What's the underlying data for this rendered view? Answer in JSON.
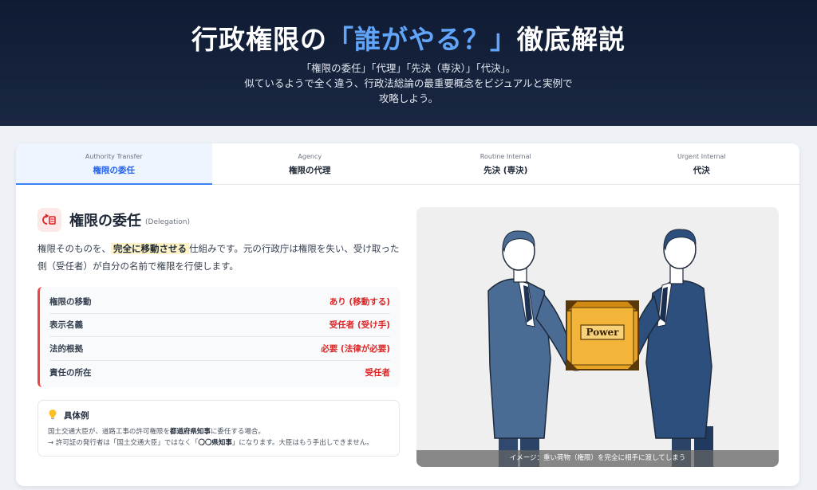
{
  "hero": {
    "title_pre": "行政権限の",
    "title_accent": "「誰がやる？」",
    "title_post": "徹底解説",
    "sub_line1": "「権限の委任」「代理」「先決（専決）」「代決」。",
    "sub_line2": "似ているようで全く違う、行政法総論の最重要概念をビジュアルと実例で",
    "sub_line3": "攻略しよう。"
  },
  "tabs": [
    {
      "en": "Authority Transfer",
      "jp": "権限の委任",
      "active": true
    },
    {
      "en": "Agency",
      "jp": "権限の代理",
      "active": false
    },
    {
      "en": "Routine Internal",
      "jp": "先決 (専決)",
      "active": false
    },
    {
      "en": "Urgent Internal",
      "jp": "代決",
      "active": false
    }
  ],
  "section": {
    "icon": "transfer-document-icon",
    "title": "権限の委任",
    "title_en": "(Delegation)",
    "desc_pre": "権限そのものを、",
    "desc_highlight": "完全に移動させる",
    "desc_post": "仕組みです。元の行政庁は権限を失い、受け取った側（受任者）が自分の名前で権限を行使します。"
  },
  "properties": [
    {
      "label": "権限の移動",
      "value": "あり (移動する)"
    },
    {
      "label": "表示名義",
      "value": "受任者 (受け手)"
    },
    {
      "label": "法的根拠",
      "value": "必要 (法律が必要)"
    },
    {
      "label": "責任の所在",
      "value": "受任者"
    }
  ],
  "example": {
    "icon": "lightbulb-icon",
    "title": "具体例",
    "line1_pre": "国土交通大臣が、道路工事の許可権限を",
    "line1_bold": "都道府県知事",
    "line1_post": "に委任する場合。",
    "line2_pre": "→ 許可証の発行者は「国土交通大臣」ではなく「",
    "line2_bold": "〇〇県知事",
    "line2_post": "」になります。大臣はもう手出しできません。"
  },
  "illustration": {
    "box_label": "Power",
    "caption": "イメージ：重い荷物（権限）を完全に相手に渡してしまう"
  },
  "colors": {
    "accent": "#60a5fa",
    "tab_active": "#2563eb",
    "value_red": "#dc2626",
    "box_gold": "#e7a322"
  }
}
